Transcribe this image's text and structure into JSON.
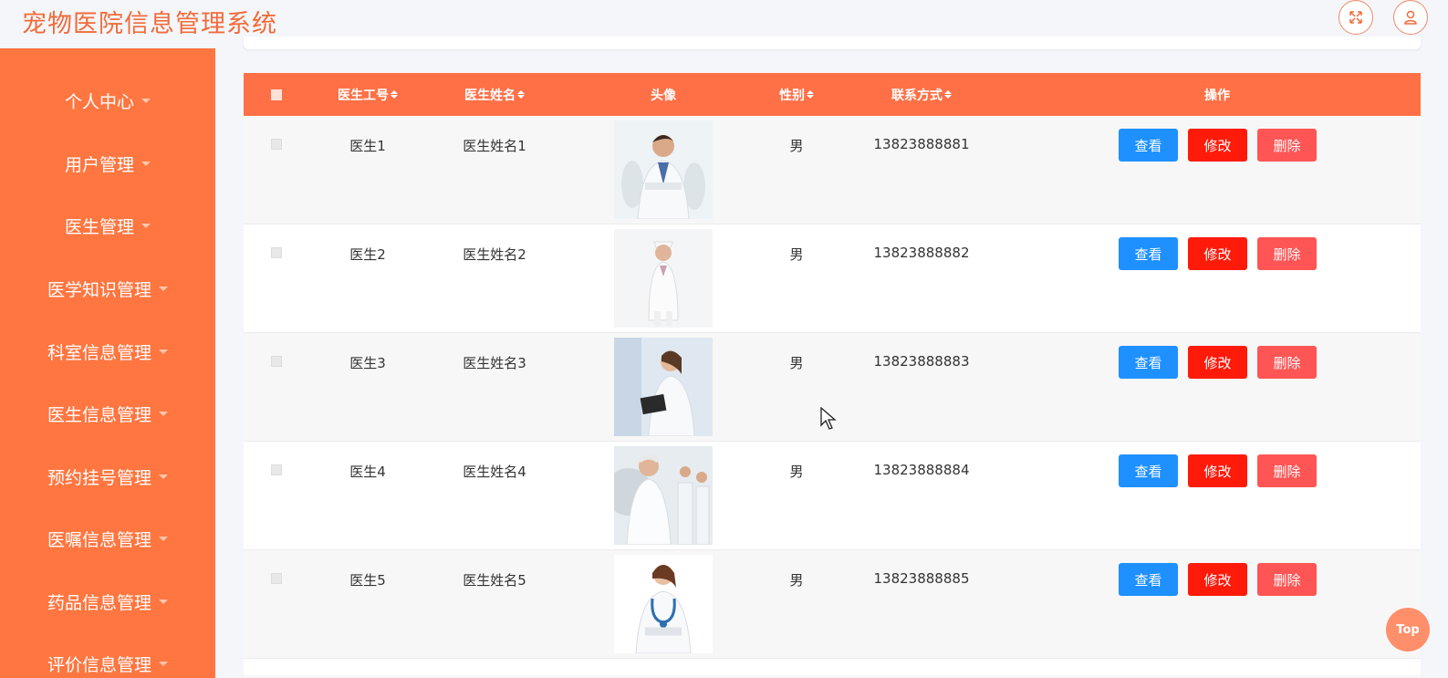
{
  "app": {
    "title": "宠物医院信息管理系统"
  },
  "header_icons": [
    "fullscreen-icon",
    "user-icon"
  ],
  "sidebar": {
    "items": [
      {
        "label": "个人中心"
      },
      {
        "label": "用户管理"
      },
      {
        "label": "医生管理"
      },
      {
        "label": "医学知识管理"
      },
      {
        "label": "科室信息管理"
      },
      {
        "label": "医生信息管理"
      },
      {
        "label": "预约挂号管理"
      },
      {
        "label": "医嘱信息管理"
      },
      {
        "label": "药品信息管理"
      },
      {
        "label": "评价信息管理"
      }
    ]
  },
  "table": {
    "columns": {
      "id": "医生工号",
      "name": "医生姓名",
      "avatar": "头像",
      "gender": "性别",
      "phone": "联系方式",
      "actions": "操作"
    },
    "rows": [
      {
        "id": "医生1",
        "name": "医生姓名1",
        "gender": "男",
        "phone": "13823888881"
      },
      {
        "id": "医生2",
        "name": "医生姓名2",
        "gender": "男",
        "phone": "13823888882"
      },
      {
        "id": "医生3",
        "name": "医生姓名3",
        "gender": "男",
        "phone": "13823888883"
      },
      {
        "id": "医生4",
        "name": "医生姓名4",
        "gender": "男",
        "phone": "13823888884"
      },
      {
        "id": "医生5",
        "name": "医生姓名5",
        "gender": "男",
        "phone": "13823888885"
      }
    ],
    "actions": {
      "view": "查看",
      "edit": "修改",
      "delete": "删除"
    }
  },
  "back_to_top": "Top",
  "colors": {
    "accent": "#ff7640",
    "header": "#ff7046",
    "view": "#1e90ff",
    "edit": "#ff1a0a",
    "delete": "#ff5555"
  }
}
